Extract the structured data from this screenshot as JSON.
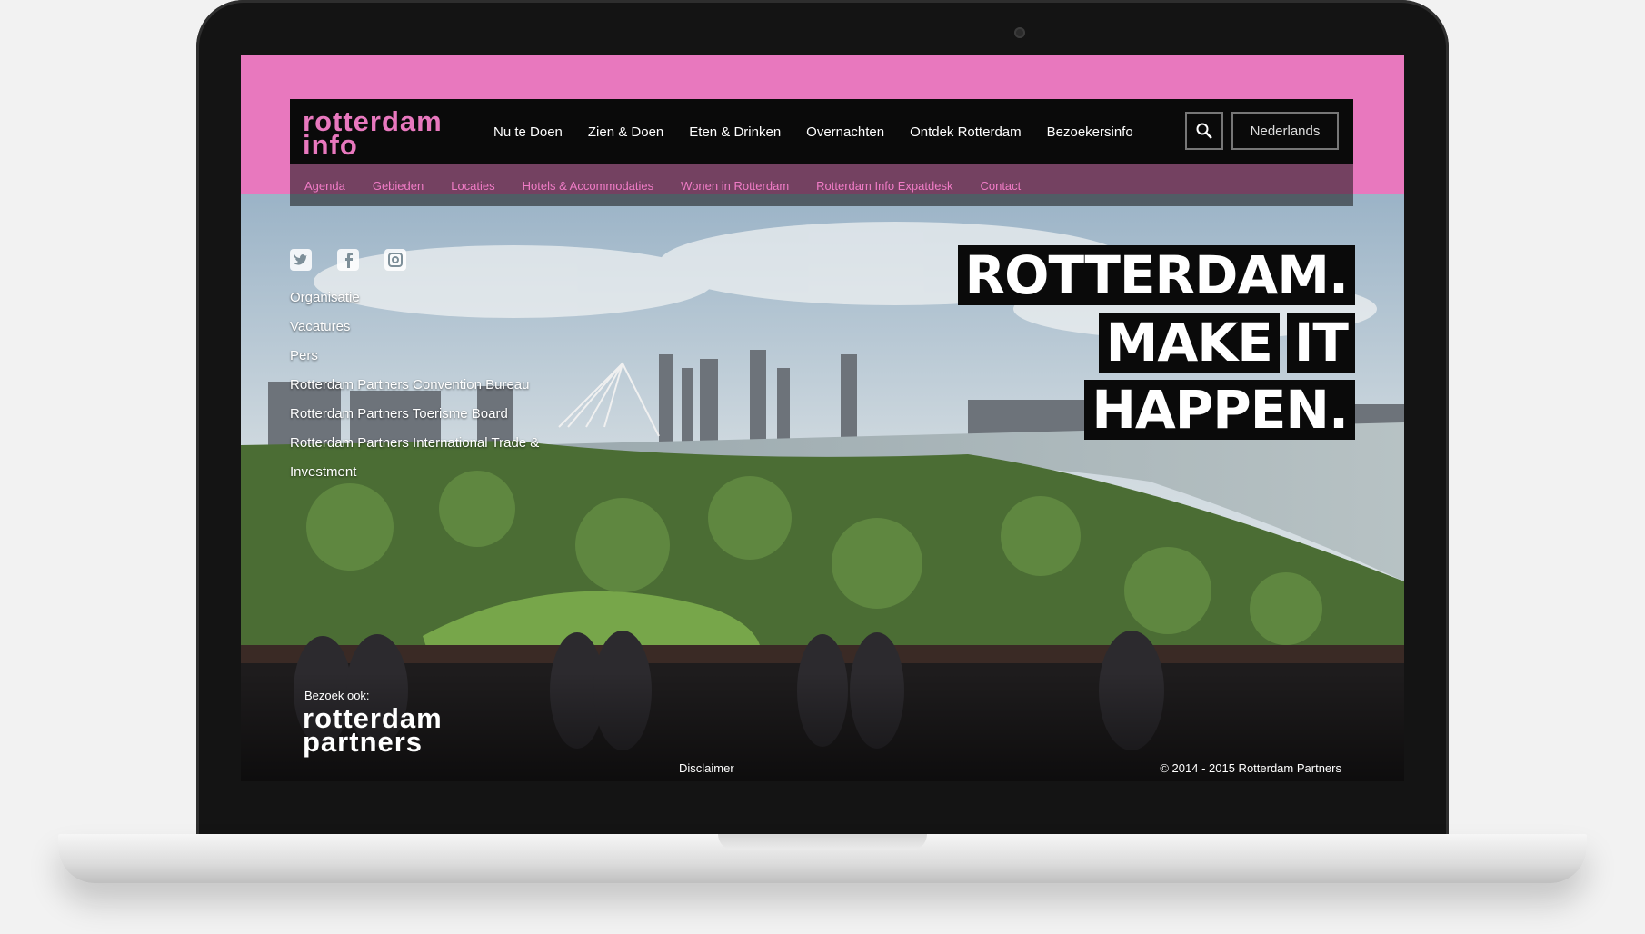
{
  "site": {
    "logo_line1": "rotterdam",
    "logo_line2": "info"
  },
  "nav": {
    "items": [
      {
        "label": "Nu te Doen"
      },
      {
        "label": "Zien & Doen"
      },
      {
        "label": "Eten & Drinken"
      },
      {
        "label": "Overnachten"
      },
      {
        "label": "Ontdek Rotterdam"
      },
      {
        "label": "Bezoekersinfo"
      }
    ],
    "search_icon": "search-icon",
    "language": "Nederlands"
  },
  "subnav": {
    "items": [
      {
        "label": "Agenda"
      },
      {
        "label": "Gebieden"
      },
      {
        "label": "Locaties"
      },
      {
        "label": "Hotels & Accommodaties"
      },
      {
        "label": "Wonen in Rotterdam"
      },
      {
        "label": "Rotterdam Info Expatdesk"
      },
      {
        "label": "Contact"
      }
    ]
  },
  "social": {
    "icons": [
      "twitter-icon",
      "facebook-icon",
      "instagram-icon"
    ]
  },
  "side_links": [
    "Organisatie",
    "Vacatures",
    "Pers",
    "Rotterdam Partners Convention Bureau",
    "Rotterdam Partners Toerisme Board",
    "Rotterdam Partners International Trade & Investment"
  ],
  "headline": {
    "line1": "ROTTERDAM.",
    "line2a": "MAKE",
    "line2b": "IT",
    "line3": "HAPPEN."
  },
  "footer": {
    "visit_label": "Bezoek ook:",
    "partners_line1": "rotterdam",
    "partners_line2": "partners",
    "disclaimer": "Disclaimer",
    "copyright": "© 2014 - 2015 Rotterdam Partners"
  },
  "colors": {
    "brand_pink": "#e878be",
    "nav_black": "#0a0a0a"
  }
}
